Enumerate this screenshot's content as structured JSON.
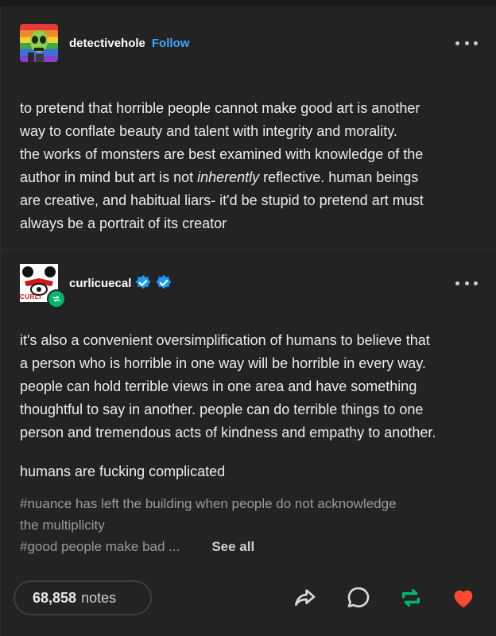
{
  "post1": {
    "username": "detectivehole",
    "follow_label": "Follow",
    "text_lines": [
      "to pretend that horrible people cannot make good art is another",
      "way to conflate beauty and talent with integrity and morality.",
      "the works of monsters are best examined with knowledge of the",
      "author in mind but art is not ",
      "inherently",
      " reflective. human beings",
      "are creative, and habitual liars- it'd be stupid to pretend art must",
      "always be a portrait of its creator"
    ]
  },
  "post2": {
    "username": "curlicuecal",
    "avatar_text": "CURLI",
    "text_lines": [
      "it's also a convenient oversimplification of humans to believe that",
      "a person who is horrible in one way will be horrible in every way.",
      "people can hold terrible views in one area and have something",
      "thoughtful to say in another. people can do terrible things to one",
      "person and tremendous acts of kindness and empathy to another."
    ],
    "closing": "humans are fucking complicated",
    "tags": [
      "#nuance has left the building when people do not acknowledge",
      "the multiplicity",
      "#good people make bad ..."
    ],
    "see_all": "See all"
  },
  "footer": {
    "notes_count": "68,858",
    "notes_label": "notes"
  },
  "icons": {
    "share": "share-icon",
    "reply": "reply-icon",
    "reblog": "reblog-icon",
    "like": "heart-icon",
    "more": "more-options-icon",
    "verified": "verified-badge-icon"
  },
  "colors": {
    "background": "#232323",
    "follow": "#3ea7ff",
    "verified": "#1d9bf0",
    "reblog": "#00b66b",
    "like": "#ff4930"
  }
}
